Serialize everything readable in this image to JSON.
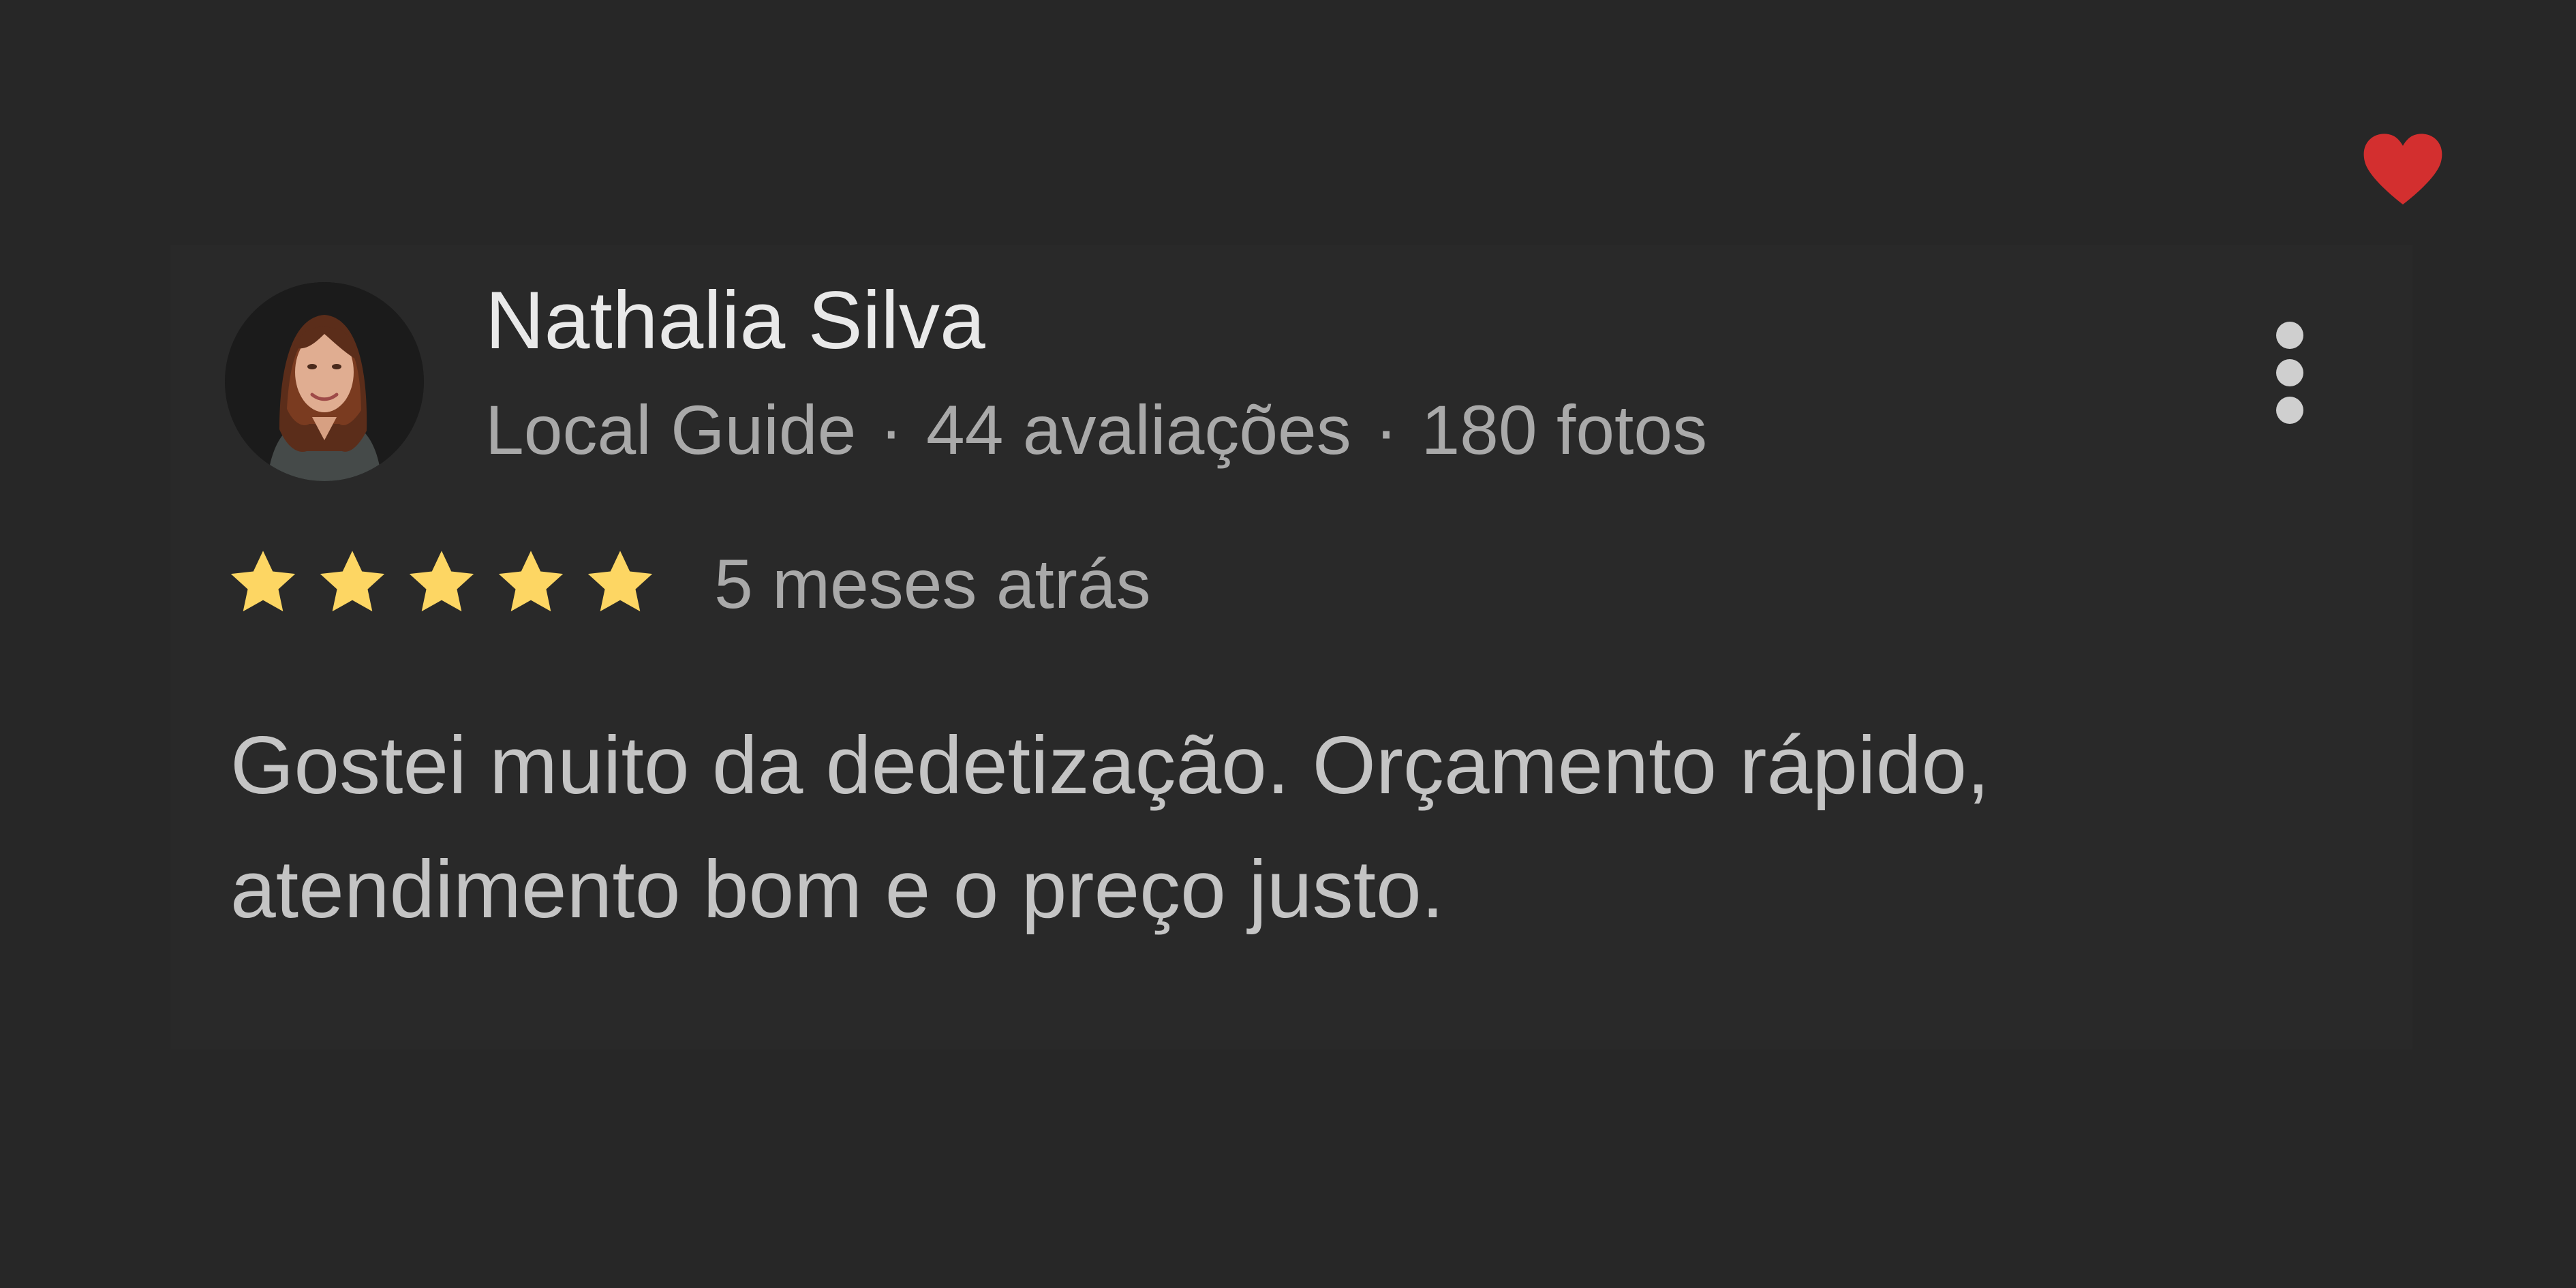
{
  "review": {
    "reviewer_name": "Nathalia Silva",
    "badge": "Local Guide",
    "separator": "·",
    "reviews_count": "44 avaliações",
    "photos_count": "180 fotos",
    "rating": 5,
    "max_rating": 5,
    "time": "5 meses atrás",
    "text": "Gostei muito da dedetização. Orçamento rápido, atendimento bom e o preço justo."
  },
  "icons": {
    "heart": "heart-icon",
    "more": "more-vert-icon",
    "star": "star-icon"
  },
  "colors": {
    "background": "#272727",
    "card": "#292929",
    "heart": "#D32F2F",
    "star": "#FDD663",
    "name_text": "#E9E9E9",
    "secondary_text": "#A9A9A9",
    "body_text": "#C4C4C4"
  }
}
